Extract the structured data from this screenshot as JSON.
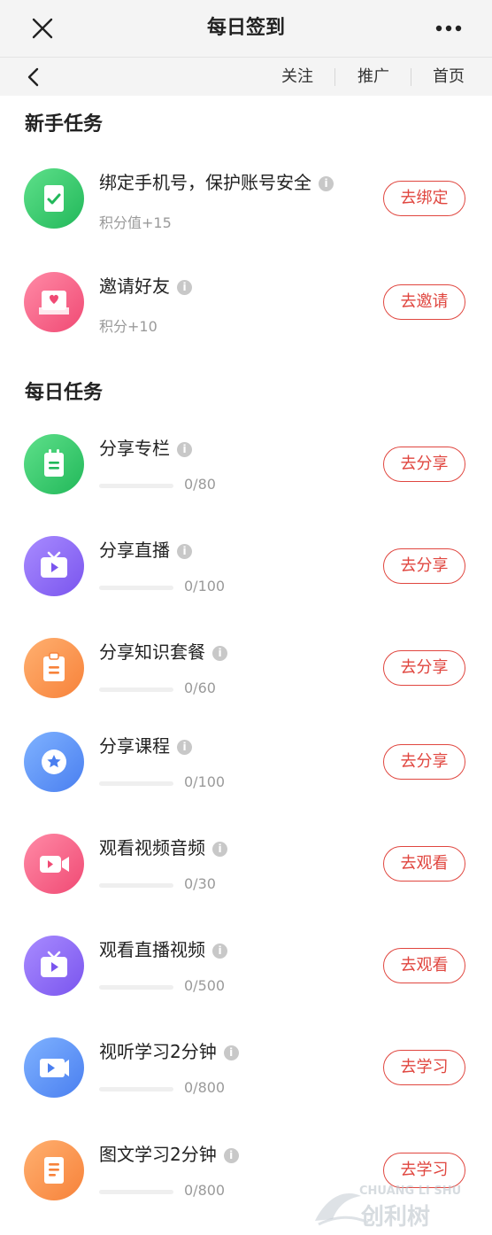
{
  "window": {
    "title": "每日签到"
  },
  "nav": {
    "links": [
      "关注",
      "推广",
      "首页"
    ]
  },
  "sections": [
    {
      "title": "新手任务",
      "tasks": [
        {
          "name": "绑定手机号，保护账号安全",
          "sub": "积分值+15",
          "button": "去绑定",
          "icon": "clipboard-check-icon",
          "color_from": "#5ee08a",
          "color_to": "#22b85a"
        },
        {
          "name": "邀请好友",
          "sub": "积分+10",
          "button": "去邀请",
          "icon": "heart-inbox-icon",
          "color_from": "#ff8aa6",
          "color_to": "#f04a74"
        }
      ]
    },
    {
      "title": "每日任务",
      "tasks": [
        {
          "name": "分享专栏",
          "progress": "0/80",
          "progress_fraction": 0,
          "button": "去分享",
          "icon": "notebook-icon",
          "color_from": "#5ee08a",
          "color_to": "#22b85a"
        },
        {
          "name": "分享直播",
          "progress": "0/100",
          "progress_fraction": 0,
          "button": "去分享",
          "icon": "tv-play-icon",
          "color_from": "#a88bff",
          "color_to": "#7a55ee"
        },
        {
          "name": "分享知识套餐",
          "progress": "0/60",
          "progress_fraction": 0,
          "button": "去分享",
          "icon": "clipboard-list-icon",
          "color_from": "#ffb070",
          "color_to": "#f7823a"
        },
        {
          "name": "分享课程",
          "progress": "0/100",
          "progress_fraction": 0,
          "button": "去分享",
          "icon": "star-badge-icon",
          "color_from": "#7fb2ff",
          "color_to": "#4a7ff0"
        },
        {
          "name": "观看视频音频",
          "progress": "0/30",
          "progress_fraction": 0,
          "button": "去观看",
          "icon": "video-camera-icon",
          "color_from": "#ff8aa6",
          "color_to": "#f04a74"
        },
        {
          "name": "观看直播视频",
          "progress": "0/500",
          "progress_fraction": 0,
          "button": "去观看",
          "icon": "tv-play-icon",
          "color_from": "#a88bff",
          "color_to": "#7a55ee"
        },
        {
          "name": "视听学习2分钟",
          "progress": "0/800",
          "progress_fraction": 0,
          "button": "去学习",
          "icon": "video-clip-icon",
          "color_from": "#7fb2ff",
          "color_to": "#4a7ff0"
        },
        {
          "name": "图文学习2分钟",
          "progress": "0/800",
          "progress_fraction": 0,
          "button": "去学习",
          "icon": "document-icon",
          "color_from": "#ffb070",
          "color_to": "#f7823a"
        }
      ]
    }
  ],
  "watermark": {
    "line1": "CHUANG LI SHU",
    "line2": "创利树"
  }
}
